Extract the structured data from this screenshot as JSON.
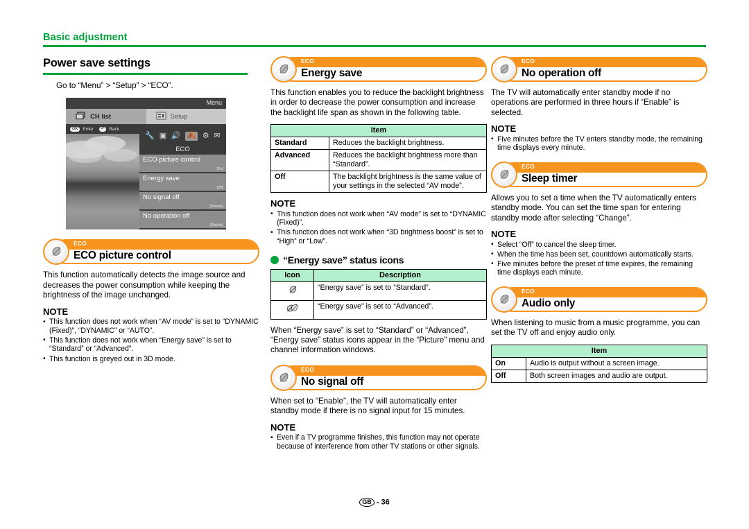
{
  "running_head": {
    "title": "Basic adjustment"
  },
  "footer": {
    "region": "GB",
    "separator": "-",
    "page": "36"
  },
  "colors": {
    "green": "#00a33b",
    "orange": "#f7941d",
    "table_header": "#b4f0cd"
  },
  "column1": {
    "section_title": "Power save settings",
    "intro": "Go to “Menu” > “Setup” > “ECO”.",
    "osd": {
      "menu_label": "Menu",
      "tab_ch_list": "CH list",
      "tab_setup": "Setup",
      "hint_enter_key": "OK",
      "hint_enter": "Enter",
      "hint_back_key": "↶",
      "hint_back": "Back",
      "category_label": "ECO",
      "items": [
        {
          "label": "ECO picture control",
          "value": "[On]"
        },
        {
          "label": "Energy save",
          "value": "[Off]"
        },
        {
          "label": "No signal off",
          "value": "[Disable]"
        },
        {
          "label": "No operation off",
          "value": "[Disable]"
        }
      ]
    },
    "eco_picture_control": {
      "badge": "ECO",
      "title": "ECO picture control",
      "body": "This function automatically detects the image source and decreases the power consumption while keeping the brightness of the image unchanged.",
      "note_title": "NOTE",
      "notes": [
        "This function does not work when “AV mode” is set to “DYNAMIC (Fixed)”, “DYNAMIC” or “AUTO”.",
        "This function does not work when “Energy save” is set to “Standard” or “Advanced”.",
        "This function is greyed out in 3D mode."
      ]
    }
  },
  "column2": {
    "energy_save": {
      "badge": "ECO",
      "title": "Energy save",
      "body": "This function enables you to reduce the backlight brightness in order to decrease the power consumption and increase the backlight life span as shown in the following table.",
      "table": {
        "header": "Item",
        "rows": [
          {
            "key": "Standard",
            "desc": "Reduces the backlight brightness."
          },
          {
            "key": "Advanced",
            "desc": "Reduces the backlight brightness more than “Standard”."
          },
          {
            "key": "Off",
            "desc": "The backlight brightness is the same value of your settings in the selected “AV mode”."
          }
        ]
      },
      "note_title": "NOTE",
      "notes": [
        "This function does not work when “AV mode” is set to “DYNAMIC (Fixed)”.",
        "This function does not work when “3D brightness boost” is set to “High” or “Low”."
      ],
      "status_icons_heading": "“Energy save” status icons",
      "status_table": {
        "header_icon": "Icon",
        "header_desc": "Description",
        "rows": [
          {
            "icon": "single-leaf-icon",
            "desc": "“Energy save” is set to “Standard”."
          },
          {
            "icon": "double-leaf-icon",
            "desc": "“Energy save” is set to “Advanced”."
          }
        ]
      },
      "footer_body": "When “Energy save” is set to “Standard” or “Advanced”, “Energy save” status icons appear in the “Picture” menu and channel information windows."
    },
    "no_signal_off": {
      "badge": "ECO",
      "title": "No signal off",
      "body": "When set to “Enable”, the TV will automatically enter standby mode if there is no signal input for 15 minutes.",
      "note_title": "NOTE",
      "notes": [
        "Even if a TV programme finishes, this function may not operate because of interference from other TV stations or other signals."
      ]
    }
  },
  "column3": {
    "no_operation_off": {
      "badge": "ECO",
      "title": "No operation off",
      "body": "The TV will automatically enter standby mode if no operations are performed in three hours if “Enable” is selected.",
      "note_title": "NOTE",
      "notes": [
        "Five minutes before the TV enters standby mode, the remaining time displays every minute."
      ]
    },
    "sleep_timer": {
      "badge": "ECO",
      "title": "Sleep timer",
      "body": "Allows you to set a time when the TV automatically enters standby mode. You can set the time span for entering standby mode after selecting “Change”.",
      "note_title": "NOTE",
      "notes": [
        "Select “Off” to cancel the sleep timer.",
        "When the time has been set, countdown automatically starts.",
        "Five minutes before the preset of time expires, the remaining time displays each minute."
      ]
    },
    "audio_only": {
      "badge": "ECO",
      "title": "Audio only",
      "body": "When listening to music from a music programme, you can set the TV off and enjoy audio only.",
      "table": {
        "header": "Item",
        "rows": [
          {
            "key": "On",
            "desc": "Audio is output without a screen image."
          },
          {
            "key": "Off",
            "desc": "Both screen images and audio are output."
          }
        ]
      }
    }
  }
}
